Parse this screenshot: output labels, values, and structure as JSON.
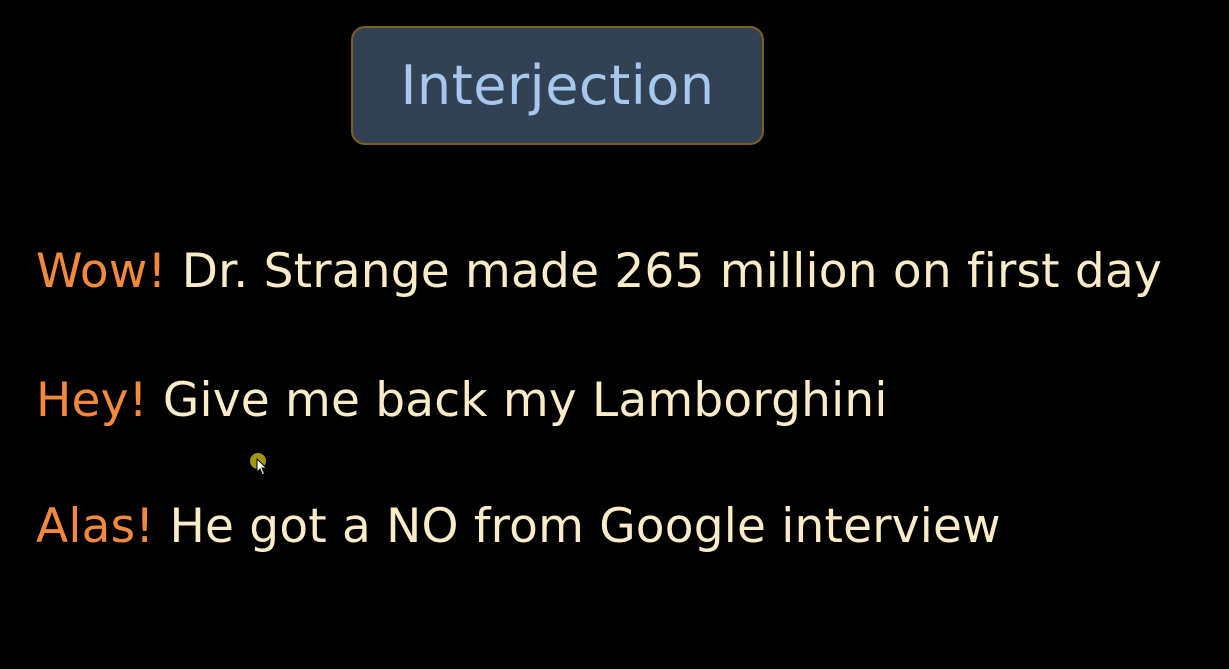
{
  "slide": {
    "title": "Interjection",
    "examples": [
      {
        "interjection": "Wow!",
        "sentence": "Dr. Strange made 265 million on first day"
      },
      {
        "interjection": "Hey!",
        "sentence": "Give me back my Lamborghini"
      },
      {
        "interjection": "Alas!",
        "sentence": "He got a NO from Google interview"
      }
    ]
  },
  "colors": {
    "background": "#000000",
    "title_box": "#334155",
    "title_border": "#7c5f1f",
    "title_text": "#a7c8ee",
    "interjection": "#f2893c",
    "sentence": "#fbecc8",
    "cursor_highlight": "#b6a713"
  },
  "icons": {
    "cursor": "mouse-pointer-icon"
  }
}
